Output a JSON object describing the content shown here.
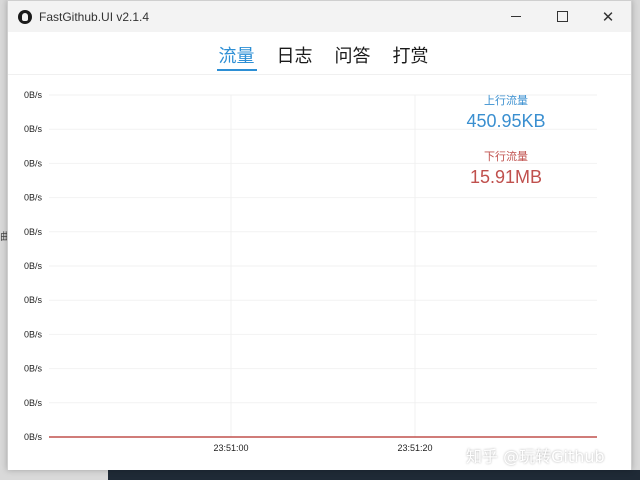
{
  "window": {
    "title": "FastGithub.UI v2.1.4",
    "controls": {
      "minimize": "—",
      "maximize": "□",
      "close": "✕"
    }
  },
  "tabs": [
    {
      "label": "流量",
      "active": true
    },
    {
      "label": "日志",
      "active": false
    },
    {
      "label": "问答",
      "active": false
    },
    {
      "label": "打赏",
      "active": false
    }
  ],
  "stats": {
    "upload": {
      "label": "上行流量",
      "value": "450.95KB",
      "color": "#3a8fd0"
    },
    "download": {
      "label": "下行流量",
      "value": "15.91MB",
      "color": "#c0504d"
    }
  },
  "chart_data": {
    "type": "line",
    "x": [
      "23:51:00",
      "23:51:20"
    ],
    "yticks": [
      "0B/s",
      "0B/s",
      "0B/s",
      "0B/s",
      "0B/s",
      "0B/s",
      "0B/s",
      "0B/s",
      "0B/s",
      "0B/s",
      "0B/s"
    ],
    "series": [
      {
        "values": [
          0,
          0
        ],
        "color": "#c0504d"
      }
    ],
    "grid": true
  },
  "watermark": "知乎 @玩转Github",
  "background": {
    "left_glyph": "曲"
  }
}
